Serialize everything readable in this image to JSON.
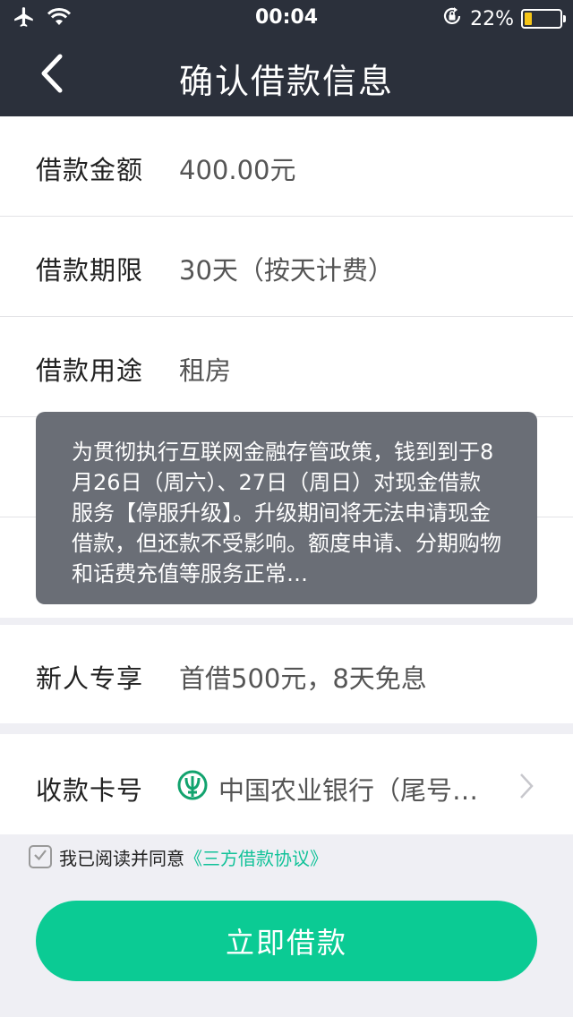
{
  "status_bar": {
    "time": "00:04",
    "battery_text": "22%",
    "battery_level": 0.22,
    "icons": [
      "airplane-icon",
      "wifi-icon",
      "rotation-lock-icon",
      "battery-icon"
    ]
  },
  "nav": {
    "title": "确认借款信息",
    "back_icon": "chevron-left-icon"
  },
  "rows": [
    {
      "label": "借款金额",
      "value": "400.00元"
    },
    {
      "label": "借款期限",
      "value": "30天（按天计费）"
    },
    {
      "label": "借款用途",
      "value": "租房"
    }
  ],
  "toast": {
    "message": "为贯彻执行互联网金融存管政策，钱到到于8月26日（周六）、27日（周日）对现金借款服务【停服升级】。升级期间将无法申请现金借款，但还款不受影响。额度申请、分期购物和话费充值等服务正常…"
  },
  "promo": {
    "label": "新人专享",
    "value": "首借500元，8天免息"
  },
  "bank": {
    "label": "收款卡号",
    "name": "中国农业银行（尾号…",
    "icon": "abc-bank-icon",
    "icon_color": "#12a36e"
  },
  "agreement": {
    "checked": true,
    "text": "我已阅读并同意",
    "link": "《三方借款协议》"
  },
  "submit_label": "立即借款",
  "colors": {
    "header_bg": "#2b303b",
    "accent": "#0bcb94",
    "link": "#12c299",
    "battery": "#f5c518"
  }
}
